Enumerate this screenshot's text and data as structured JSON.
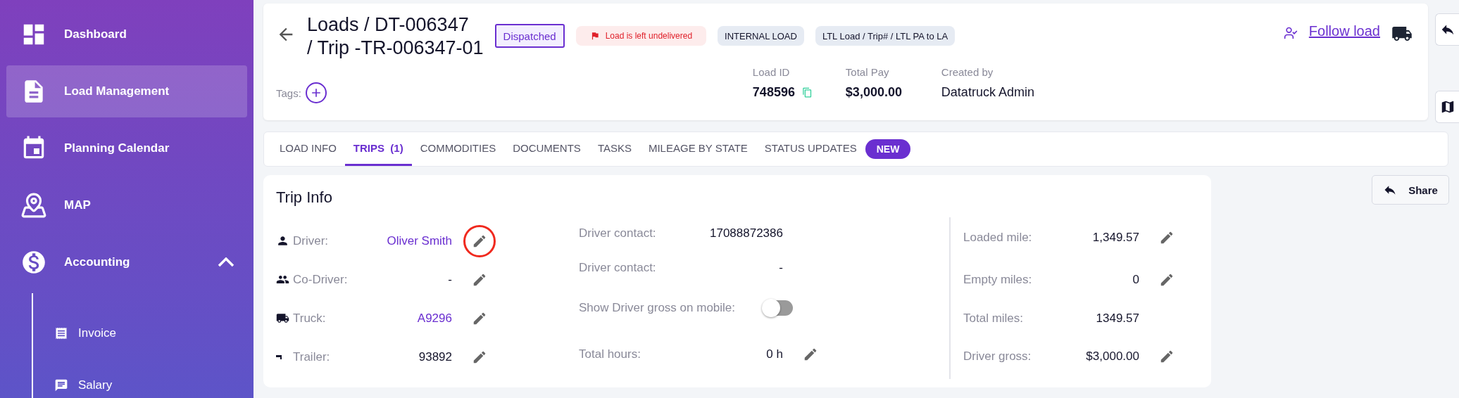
{
  "sidebar": {
    "items": [
      {
        "label": "Dashboard",
        "selected": false
      },
      {
        "label": "Load Management",
        "selected": true
      },
      {
        "label": "Planning Calendar",
        "selected": false
      },
      {
        "label": "MAP",
        "selected": false
      },
      {
        "label": "Accounting",
        "selected": false,
        "expanded": true,
        "children": [
          {
            "label": "Invoice",
            "selected": false
          },
          {
            "label": "Salary",
            "selected": false
          }
        ]
      }
    ]
  },
  "header": {
    "title_lines": [
      "Loads / DT-006347",
      "/ Trip -TR-006347-01"
    ],
    "badges": [
      {
        "kind": "status",
        "label": "Dispatched"
      },
      {
        "kind": "alert",
        "label": "Load is left undelivered"
      },
      {
        "kind": "tag",
        "label": "INTERNAL LOAD"
      },
      {
        "kind": "tag",
        "label": "LTL Load / Trip# / LTL PA to LA"
      }
    ],
    "follow_link": "Follow load",
    "tags_label": "Tags:",
    "stats": [
      {
        "label": "Load ID",
        "value": "748596",
        "copyable": true
      },
      {
        "label": "Total Pay",
        "value": "$3,000.00",
        "copyable": false
      },
      {
        "label": "Created by",
        "value": "Datatruck Admin",
        "copyable": false
      }
    ]
  },
  "tabs": [
    {
      "label": "LOAD INFO",
      "selected": false
    },
    {
      "label": "TRIPS  (1)",
      "selected": true
    },
    {
      "label": "COMMODITIES",
      "selected": false
    },
    {
      "label": "DOCUMENTS",
      "selected": false
    },
    {
      "label": "TASKS",
      "selected": false
    },
    {
      "label": "MILEAGE BY STATE",
      "selected": false
    },
    {
      "label": "STATUS UPDATES",
      "selected": false,
      "badge": "NEW"
    }
  ],
  "share_button": "Share",
  "trip_info": {
    "title": "Trip Info",
    "people": [
      {
        "label": "Driver:",
        "value": "Oliver Smith",
        "link": true,
        "highlighted": true
      },
      {
        "label": "Co-Driver:",
        "value": "-",
        "link": false,
        "highlighted": false
      },
      {
        "label": "Truck:",
        "value": "A9296",
        "link": true,
        "highlighted": false
      },
      {
        "label": "Trailer:",
        "value": "93892",
        "link": false,
        "highlighted": false
      }
    ],
    "details": [
      {
        "kind": "text",
        "label": "Driver contact:",
        "value": "17088872386",
        "editable": false
      },
      {
        "kind": "text",
        "label": "Driver contact:",
        "value": "-",
        "editable": false
      },
      {
        "kind": "toggle",
        "label": "Show Driver gross on mobile:",
        "on": false
      },
      {
        "kind": "text",
        "label": "Total hours:",
        "value": "0 h",
        "editable": true
      }
    ],
    "miles": [
      {
        "label": "Loaded mile:",
        "value": "1,349.57",
        "editable": true
      },
      {
        "label": "Empty miles:",
        "value": "0",
        "editable": true
      },
      {
        "label": "Total miles:",
        "value": "1349.57",
        "editable": false
      },
      {
        "label": "Driver gross:",
        "value": "$3,000.00",
        "editable": true
      }
    ]
  }
}
